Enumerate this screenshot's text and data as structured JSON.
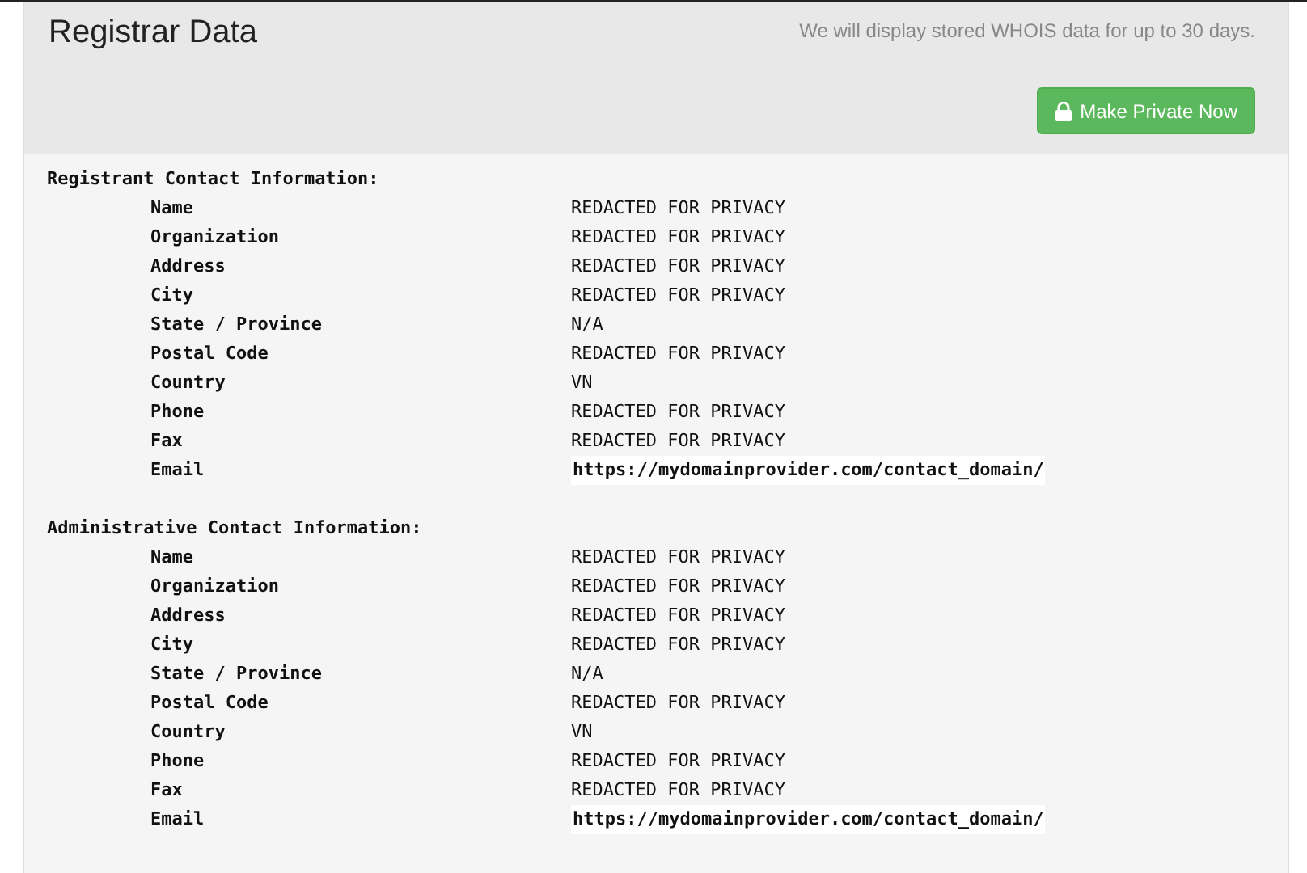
{
  "header": {
    "title": "Registrar Data",
    "note": "We will display stored WHOIS data for up to 30 days.",
    "button": "Make Private Now"
  },
  "sections": [
    {
      "heading": "Registrant Contact Information:",
      "fields": [
        {
          "label": "Name",
          "value": "REDACTED FOR PRIVACY",
          "kind": "text"
        },
        {
          "label": "Organization",
          "value": "REDACTED FOR PRIVACY",
          "kind": "text"
        },
        {
          "label": "Address",
          "value": "REDACTED FOR PRIVACY",
          "kind": "text"
        },
        {
          "label": "City",
          "value": "REDACTED FOR PRIVACY",
          "kind": "text"
        },
        {
          "label": "State / Province",
          "value": "N/A",
          "kind": "text"
        },
        {
          "label": "Postal Code",
          "value": "REDACTED FOR PRIVACY",
          "kind": "text"
        },
        {
          "label": "Country",
          "value": "VN",
          "kind": "text"
        },
        {
          "label": "Phone",
          "value": "REDACTED FOR PRIVACY",
          "kind": "text"
        },
        {
          "label": "Fax",
          "value": "REDACTED FOR PRIVACY",
          "kind": "text"
        },
        {
          "label": "Email",
          "value": "https://mydomainprovider.com/contact_domain/",
          "kind": "link"
        }
      ]
    },
    {
      "heading": "Administrative Contact Information:",
      "fields": [
        {
          "label": "Name",
          "value": "REDACTED FOR PRIVACY",
          "kind": "text"
        },
        {
          "label": "Organization",
          "value": "REDACTED FOR PRIVACY",
          "kind": "text"
        },
        {
          "label": "Address",
          "value": "REDACTED FOR PRIVACY",
          "kind": "text"
        },
        {
          "label": "City",
          "value": "REDACTED FOR PRIVACY",
          "kind": "text"
        },
        {
          "label": "State / Province",
          "value": "N/A",
          "kind": "text"
        },
        {
          "label": "Postal Code",
          "value": "REDACTED FOR PRIVACY",
          "kind": "text"
        },
        {
          "label": "Country",
          "value": "VN",
          "kind": "text"
        },
        {
          "label": "Phone",
          "value": "REDACTED FOR PRIVACY",
          "kind": "text"
        },
        {
          "label": "Fax",
          "value": "REDACTED FOR PRIVACY",
          "kind": "text"
        },
        {
          "label": "Email",
          "value": "https://mydomainprovider.com/contact_domain/",
          "kind": "link"
        }
      ]
    }
  ]
}
